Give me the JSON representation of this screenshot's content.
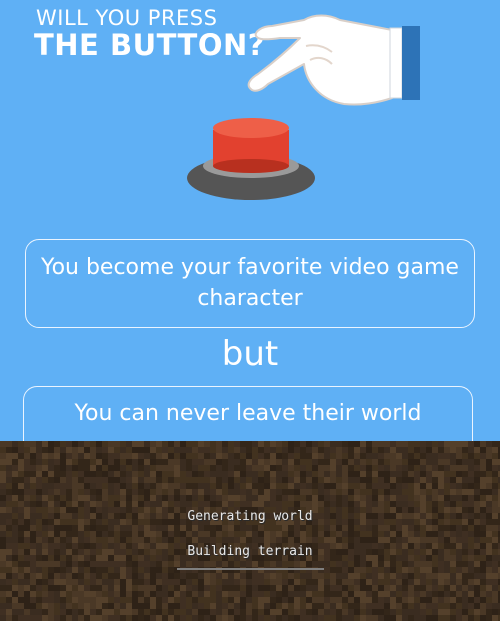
{
  "header": {
    "line1": "WILL YOU PRESS",
    "line2": "THE BUTTON?"
  },
  "dilemma": {
    "option": "You become your favorite video game character",
    "option_lines": [
      "You become your favorite video game",
      "character"
    ],
    "conjunction": "but",
    "consequence": "You can never leave their world"
  },
  "icons": {
    "hand": "pointing-hand-icon",
    "button": "big-red-button-icon"
  },
  "loading": {
    "status": "Generating world",
    "task": "Building terrain",
    "progress": 0
  },
  "colors": {
    "background": "#5fb0f5",
    "button_red": "#e2412f",
    "dirt": "#3c2e22"
  }
}
